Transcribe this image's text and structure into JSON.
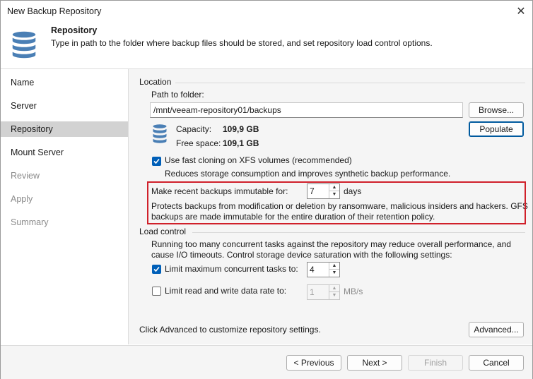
{
  "window": {
    "title": "New Backup Repository",
    "close_glyph": "✕"
  },
  "header": {
    "title": "Repository",
    "description": "Type in path to the folder where backup files should be stored, and set repository load control options."
  },
  "sidebar": {
    "items": [
      {
        "label": "Name",
        "state": "normal"
      },
      {
        "label": "Server",
        "state": "normal"
      },
      {
        "label": "Repository",
        "state": "selected"
      },
      {
        "label": "Mount Server",
        "state": "normal"
      },
      {
        "label": "Review",
        "state": "disabled"
      },
      {
        "label": "Apply",
        "state": "disabled"
      },
      {
        "label": "Summary",
        "state": "disabled"
      }
    ]
  },
  "location": {
    "group_label": "Location",
    "path_label": "Path to folder:",
    "path_value": "/mnt/veeam-repository01/backups",
    "browse_label": "Browse...",
    "capacity_label": "Capacity:",
    "capacity_value": "109,9 GB",
    "free_label": "Free space:",
    "free_value": "109,1 GB",
    "populate_label": "Populate",
    "fast_clone_label": "Use fast cloning on XFS volumes (recommended)",
    "fast_clone_checked": true,
    "fast_clone_desc": "Reduces storage consumption and improves synthetic backup performance.",
    "immutable_label": "Make recent backups immutable for:",
    "immutable_value": "7",
    "immutable_unit": "days",
    "immutable_desc_1": "Protects backups from modification or deletion by ransomware, malicious insiders and hackers. GFS",
    "immutable_desc_2": "backups are made immutable for the entire duration of their retention policy."
  },
  "load_control": {
    "group_label": "Load control",
    "desc_1": "Running too many concurrent tasks against the repository may reduce overall performance, and",
    "desc_2": "cause I/O timeouts. Control storage device saturation with the following settings:",
    "limit_tasks_label": "Limit maximum concurrent tasks to:",
    "limit_tasks_checked": true,
    "limit_tasks_value": "4",
    "limit_rate_label": "Limit read and write data rate to:",
    "limit_rate_checked": false,
    "limit_rate_value": "1",
    "limit_rate_unit": "MB/s"
  },
  "advanced": {
    "hint": "Click Advanced to customize repository settings.",
    "button_label": "Advanced..."
  },
  "footer": {
    "previous_label": "< Previous",
    "next_label": "Next >",
    "finish_label": "Finish",
    "cancel_label": "Cancel"
  },
  "colors": {
    "accent": "#005fb8",
    "highlight_border": "#d0202a",
    "db_icon": "#4a7fb5"
  },
  "icons": [
    "database-icon",
    "storage-icon",
    "close-icon",
    "checkmark-icon",
    "spin-up-icon",
    "spin-down-icon"
  ]
}
